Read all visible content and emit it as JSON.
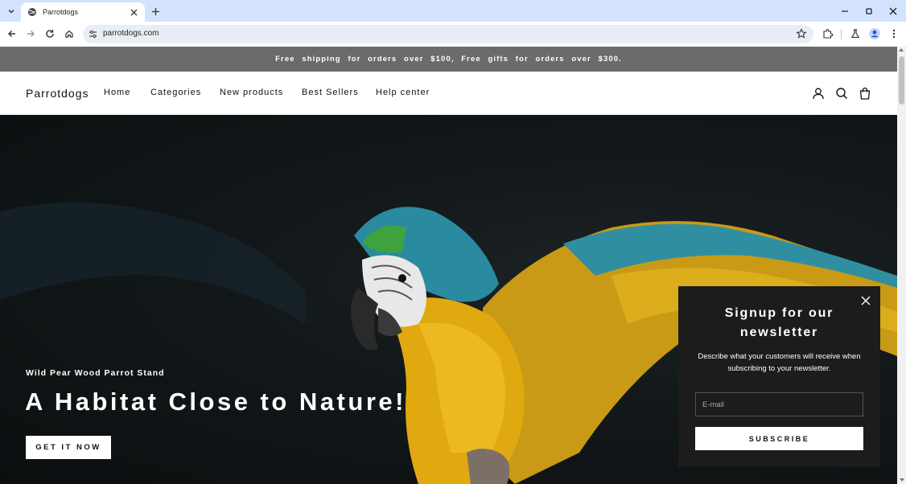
{
  "browser": {
    "tab_title": "Parrotdogs",
    "url": "parrotdogs.com"
  },
  "announcement": "Free shipping for orders over $100, Free gifts for orders over $300.",
  "header": {
    "logo": "Parrotdogs",
    "nav": [
      "Home",
      "Categories",
      "New products",
      "Best Sellers",
      "Help center"
    ],
    "icons": [
      "account-icon",
      "search-icon",
      "cart-icon"
    ]
  },
  "hero": {
    "subtitle": "Wild Pear Wood Parrot Stand",
    "title": "A Habitat Close to Nature!",
    "button": "GET IT NOW"
  },
  "newsletter": {
    "title": "Signup for our newsletter",
    "description": "Describe what your customers will receive when subscribing to your newsletter.",
    "email_placeholder": "E-mail",
    "button": "SUBSCRIBE"
  }
}
